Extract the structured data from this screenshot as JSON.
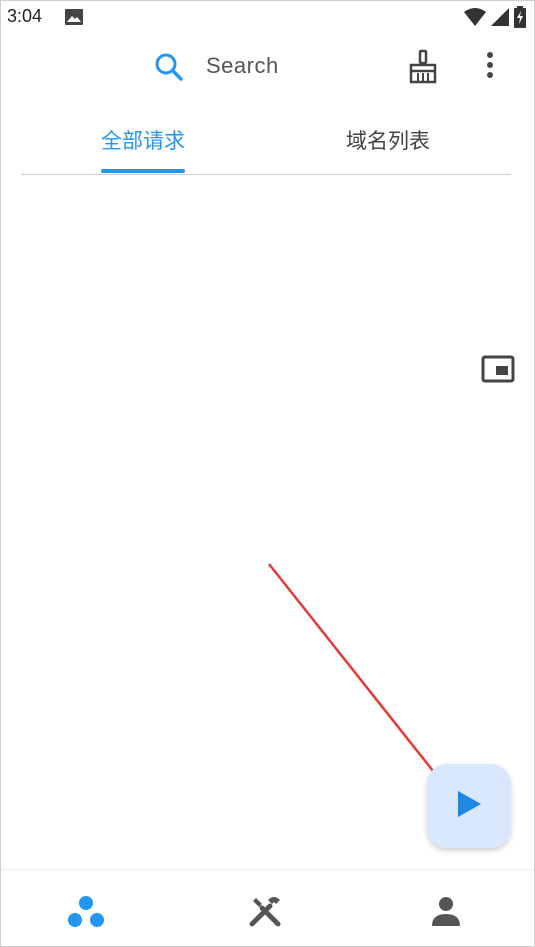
{
  "status_bar": {
    "time": "3:04",
    "icons": [
      "gallery-icon",
      "wifi-icon",
      "signal-icon",
      "battery-charging-icon"
    ]
  },
  "top_bar": {
    "search_label": "Search",
    "icons": [
      "search-icon",
      "broom-icon",
      "more-vert-icon"
    ]
  },
  "tabs": [
    {
      "label": "全部请求",
      "active": true
    },
    {
      "label": "域名列表",
      "active": false
    }
  ],
  "content": {
    "floating_icon": "picture-in-picture-icon"
  },
  "fab": {
    "icon": "play-icon"
  },
  "bottom_nav": {
    "items": [
      "network-nodes-icon",
      "tools-icon",
      "person-icon"
    ],
    "active_index": 0
  },
  "colors": {
    "accent": "#2196f3",
    "fab_bg": "#d9e8ff",
    "annotation_arrow": "#e53935",
    "icon_gray": "#555555"
  }
}
